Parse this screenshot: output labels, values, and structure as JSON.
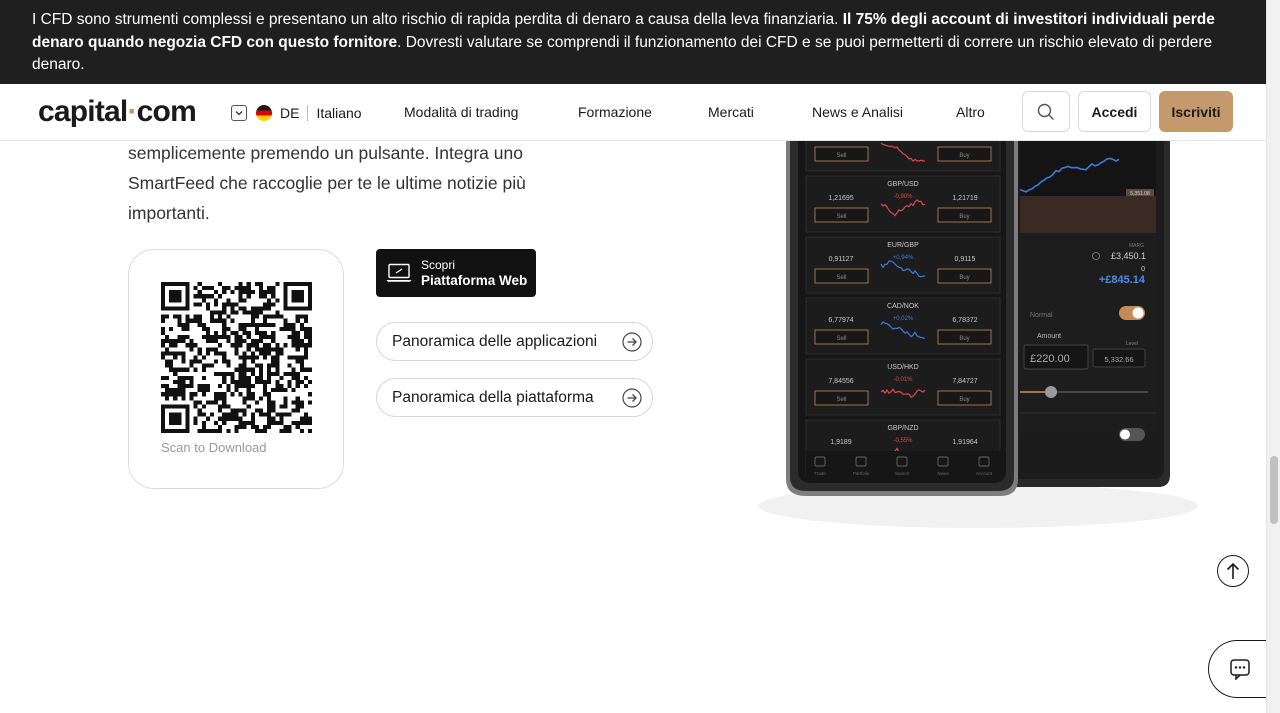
{
  "risk_banner": {
    "text_before": "I CFD sono strumenti complessi e presentano un alto rischio di rapida perdita di denaro a causa della leva finanziaria. ",
    "text_bold": "Il 75% degli account di investitori individuali perde denaro quando negozia CFD con questo fornitore",
    "text_after": ". Dovresti valutare se comprendi il funzionamento dei CFD e se puoi permetterti di correre un rischio elevato di perdere denaro."
  },
  "header": {
    "logo_left": "capital",
    "logo_dot": "·",
    "logo_right": "com",
    "region_code": "DE",
    "language": "Italiano",
    "nav": [
      "Modalità di trading",
      "Formazione",
      "Mercati",
      "News e Analisi",
      "Altro"
    ],
    "login_label": "Accedi",
    "signup_label": "Iscriviti"
  },
  "content": {
    "paragraph_lines": [
      "semplicemente premendo un pulsante. Integra uno",
      "SmartFeed che raccoglie per te le ultime notizie più",
      "importanti."
    ],
    "qr_caption": "Scan to Download",
    "web_badge_line1": "Scopri",
    "web_badge_line2": "Piattaforma Web",
    "apps_overview_label": "Panoramica delle applicazioni",
    "platform_overview_label": "Panoramica della piattaforma"
  },
  "phone_left": {
    "rows": [
      {
        "pair": "GBP/USD",
        "sell": "1,21695",
        "change": "-0,90%",
        "buy": "1,21719"
      },
      {
        "pair": "EUR/GBP",
        "sell": "0,91127",
        "change": "+0,94%",
        "buy": "0,9115"
      },
      {
        "pair": "CAD/NOK",
        "sell": "6,77974",
        "change": "+0,02%",
        "buy": "6,78372"
      },
      {
        "pair": "USD/HKD",
        "sell": "7,84556",
        "change": "-0,01%",
        "buy": "7,84727"
      },
      {
        "pair": "GBP/NZD",
        "sell": "1,9189",
        "change": "-0,55%",
        "buy": "1,91964"
      }
    ],
    "sell_label": "Sell",
    "buy_label": "Buy",
    "tabs": [
      "Trade",
      "Portfolio",
      "Search",
      "News",
      "Account"
    ]
  },
  "phone_right": {
    "price_tag": "5,351.08",
    "margin_label": "MARG",
    "balance": "£3,450.1",
    "zero": "0",
    "pnl": "+£845.14",
    "mode": "Normal",
    "amount_label": "Amount",
    "level_label": "Level",
    "amount_value": "£220.00",
    "level_value": "5,332.66"
  },
  "colors": {
    "banner_bg": "#1f1f1f",
    "accent": "#c49a6c",
    "positive": "#3d7bd9",
    "negative": "#e04848"
  },
  "icons": [
    "chevron-down-icon",
    "germany-flag-icon",
    "search-icon",
    "laptop-icon",
    "arrow-right-circle-icon",
    "arrow-up-icon",
    "chat-icon"
  ]
}
